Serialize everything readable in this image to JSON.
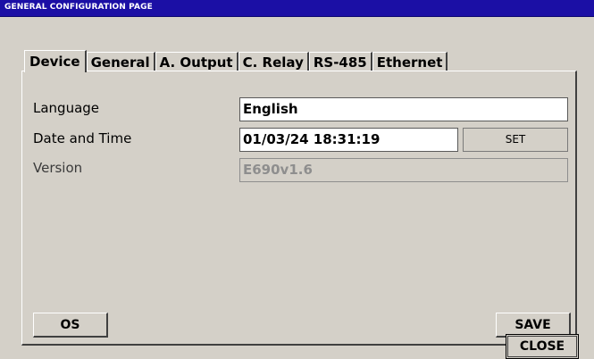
{
  "window": {
    "title": "GENERAL CONFIGURATION PAGE"
  },
  "tabs": [
    {
      "label": "Device"
    },
    {
      "label": "General"
    },
    {
      "label": "A. Output"
    },
    {
      "label": "C. Relay"
    },
    {
      "label": "RS-485"
    },
    {
      "label": "Ethernet"
    }
  ],
  "device": {
    "language_label": "Language",
    "language_value": "English",
    "datetime_label": "Date and Time",
    "datetime_value": "01/03/24 18:31:19",
    "set_label": "SET",
    "version_label": "Version",
    "version_value": "E690v1.6",
    "os_label": "OS",
    "save_label": "SAVE"
  },
  "footer": {
    "close_label": "CLOSE"
  }
}
